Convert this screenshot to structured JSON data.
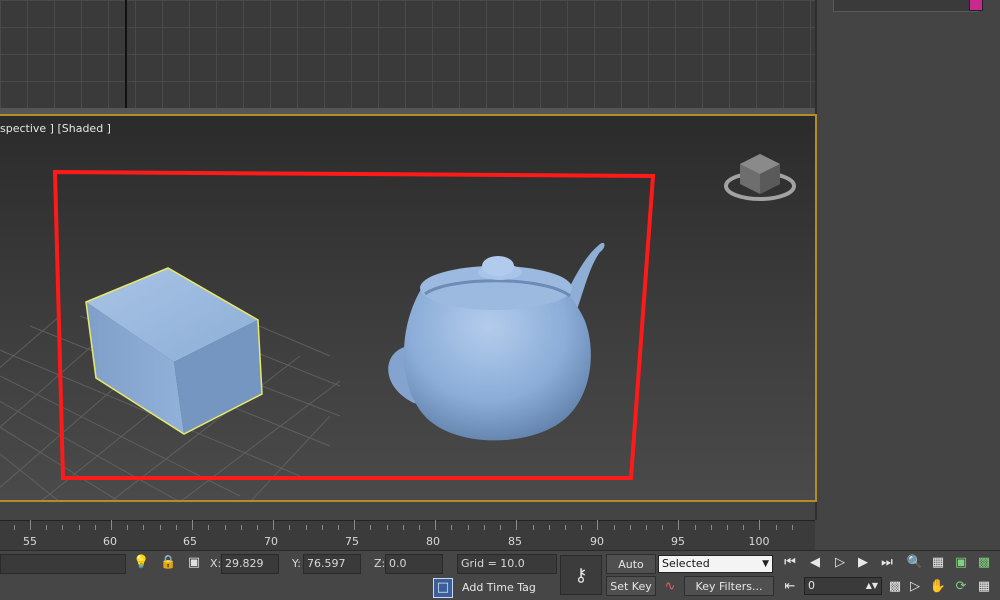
{
  "viewport": {
    "label": "spective ] [Shaded ]"
  },
  "timeline": {
    "ticks": [
      "55",
      "60",
      "65",
      "70",
      "75",
      "80",
      "85",
      "90",
      "95",
      "100"
    ]
  },
  "status": {
    "x_label": "X:",
    "x_value": "29.829",
    "y_label": "Y:",
    "y_value": "76.597",
    "z_label": "Z:",
    "z_value": "0.0",
    "grid": "Grid = 10.0",
    "add_time_tag": "Add Time Tag",
    "auto_key": "Auto Key",
    "set_key": "Set Key",
    "key_filters": "Key Filters...",
    "selected_option": "Selected",
    "current_frame": "0"
  },
  "colors": {
    "selection_box": "#ff1a1a",
    "object_fill": "#8fb0d8",
    "viewport_border": "#b28d2a",
    "swatch": "#c62a8c"
  },
  "icons": {
    "key": "key-icon",
    "lightbulb": "lightbulb-icon",
    "lock": "lock-icon",
    "transform": "absolute-mode-icon",
    "curve": "curve-editor-icon",
    "time_tag": "time-tag-icon"
  }
}
